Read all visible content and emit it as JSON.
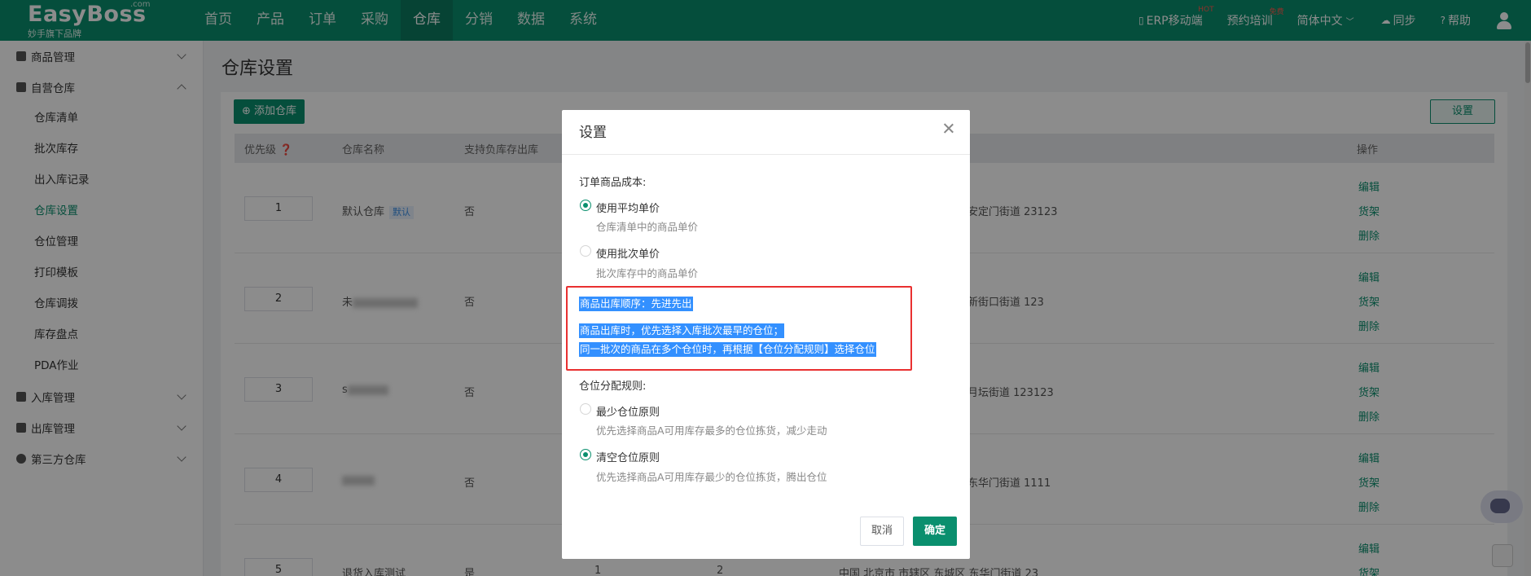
{
  "brand": {
    "name": "EasyBoss",
    "com": ".com",
    "slogan": "妙手旗下品牌"
  },
  "topnav": {
    "menu": [
      "首页",
      "产品",
      "订单",
      "采购",
      "仓库",
      "分销",
      "数据",
      "系统"
    ],
    "active": "仓库",
    "right": {
      "erp_mobile": "ERP移动端",
      "erp_badge": "HOT",
      "training": "预约培训",
      "training_badge": "免费",
      "language": "简体中文",
      "sync": "同步",
      "help": "帮助"
    }
  },
  "sidebar": {
    "groups": [
      {
        "label": "商品管理",
        "icon": "product-icon",
        "expanded": false
      },
      {
        "label": "自营仓库",
        "icon": "warehouse-icon",
        "expanded": true,
        "items": [
          "仓库清单",
          "批次库存",
          "出入库记录",
          "仓库设置",
          "仓位管理",
          "打印模板",
          "仓库调拨",
          "库存盘点",
          "PDA作业"
        ],
        "active": "仓库设置"
      },
      {
        "label": "入库管理",
        "icon": "inbound-icon",
        "expanded": false
      },
      {
        "label": "出库管理",
        "icon": "outbound-icon",
        "expanded": false
      },
      {
        "label": "第三方仓库",
        "icon": "third-party-icon",
        "expanded": false
      }
    ]
  },
  "page": {
    "title": "仓库设置",
    "add_button": "添加仓库",
    "settings_button": "设置",
    "columns": [
      "优先级",
      "仓库名称",
      "支持负库存出库",
      "操作"
    ],
    "rows": [
      {
        "priority": "1",
        "name": "默认仓库",
        "tag": "默认",
        "negative": "否",
        "address": "安定门街道 23123",
        "ops": [
          "编辑",
          "货架",
          "删除"
        ]
      },
      {
        "priority": "2",
        "name": "未",
        "negative": "否",
        "address": "新街口街道 123",
        "ops": [
          "编辑",
          "货架",
          "删除"
        ]
      },
      {
        "priority": "3",
        "name": "s",
        "negative": "否",
        "address": "月坛街道 123123",
        "ops": [
          "编辑",
          "货架",
          "删除"
        ]
      },
      {
        "priority": "4",
        "name": "",
        "negative": "否",
        "address": "东华门街道 1111",
        "ops": [
          "编辑",
          "货架",
          "删除"
        ]
      },
      {
        "priority": "5",
        "name": "退货入库测试",
        "negative": "是",
        "col3": "1",
        "col4": "2",
        "address": "中国 北京市 市辖区 东城区 东华门街道 23",
        "ops": [
          "编辑",
          "货架"
        ]
      }
    ]
  },
  "modal": {
    "title": "设置",
    "cost_label": "订单商品成本:",
    "cost_options": [
      {
        "title": "使用平均单价",
        "desc": "仓库清单中的商品单价",
        "selected": true
      },
      {
        "title": "使用批次单价",
        "desc": "批次库存中的商品单价",
        "selected": false
      }
    ],
    "outbound_order": "商品出库顺序：先进先出",
    "outbound_line1": "商品出库时，优先选择入库批次最早的仓位；",
    "outbound_line2": "同一批次的商品在多个仓位时，再根据【仓位分配规则】选择仓位",
    "alloc_label": "仓位分配规则:",
    "alloc_options": [
      {
        "title": "最少仓位原则",
        "desc": "优先选择商品A可用库存最多的仓位拣货，减少走动",
        "selected": false
      },
      {
        "title": "清空仓位原则",
        "desc": "优先选择商品A可用库存最少的仓位拣货，腾出仓位",
        "selected": true
      }
    ],
    "cancel": "取消",
    "ok": "确定"
  },
  "colors": {
    "brand": "#0a8f6e",
    "highlight": "#3390ff",
    "annotation": "#e93030"
  }
}
